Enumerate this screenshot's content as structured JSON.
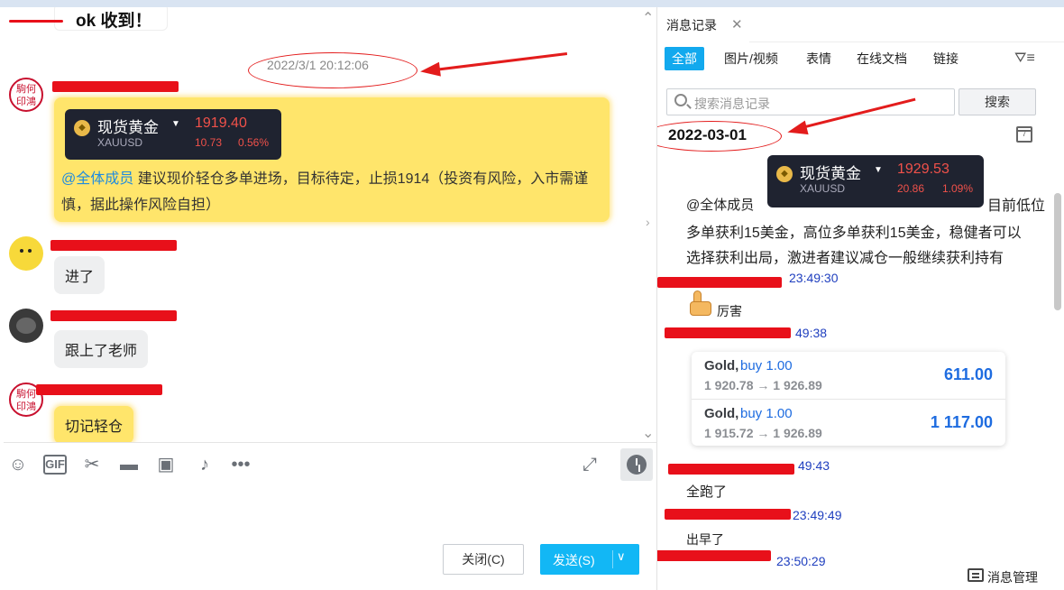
{
  "chat": {
    "prev_message": "ok 收到！",
    "timestamp": "2022/3/1 20:12:06",
    "seal_text": "駒何印鴻",
    "gold_card": {
      "name": "现货黄金",
      "symbol": "XAUUSD",
      "price": "1919.40",
      "change": "10.73",
      "change_pct": "0.56%"
    },
    "announcement_mention": "@全体成员",
    "announcement_text": "建议现价轻仓多单进场，目标待定，止损1914（投资有风险，入市需谨慎，据此操作风险自担）",
    "msg_entered": "进了",
    "msg_followed": "跟上了老师",
    "msg_reminder": "切记轻仓"
  },
  "toolbar": {
    "icons": [
      "emoji-icon",
      "gif-icon",
      "scissors-icon",
      "folder-icon",
      "image-icon",
      "bell-icon",
      "more-icon",
      "expand-icon",
      "history-icon"
    ],
    "gif_label": "GIF"
  },
  "actions": {
    "close_label": "关闭(C)",
    "send_label": "发送(S)"
  },
  "history": {
    "tab_title": "消息记录",
    "filters": [
      "全部",
      "图片/视频",
      "表情",
      "在线文档",
      "链接"
    ],
    "search_placeholder": "搜索消息记录",
    "search_button": "搜索",
    "date": "2022-03-01",
    "gold_card": {
      "name": "现货黄金",
      "symbol": "XAUUSD",
      "price": "1929.53",
      "change": "20.86",
      "change_pct": "1.09%"
    },
    "update_mention": "@全体成员",
    "update_line1_tail": "目前低位",
    "update_line2": "多单获利15美金，高位多单获利15美金，稳健者可以",
    "update_line3": "选择获利出局，激进者建议减仓一般继续获利持有",
    "time1": "23:49:30",
    "msg_great": "厉害",
    "time2": "49:38",
    "trades": [
      {
        "symbol": "Gold,",
        "side": "buy 1.00",
        "prices": "1 920.78 → 1 926.89",
        "profit": "611.00"
      },
      {
        "symbol": "Gold,",
        "side": "buy 1.00",
        "prices": "1 915.72 → 1 926.89",
        "profit": "1 117.00"
      }
    ],
    "time3": "49:43",
    "msg_all_out": "全跑了",
    "time4": "23:49:49",
    "msg_out_early": "出早了",
    "time5": "23:50:29",
    "footer": "消息管理"
  }
}
